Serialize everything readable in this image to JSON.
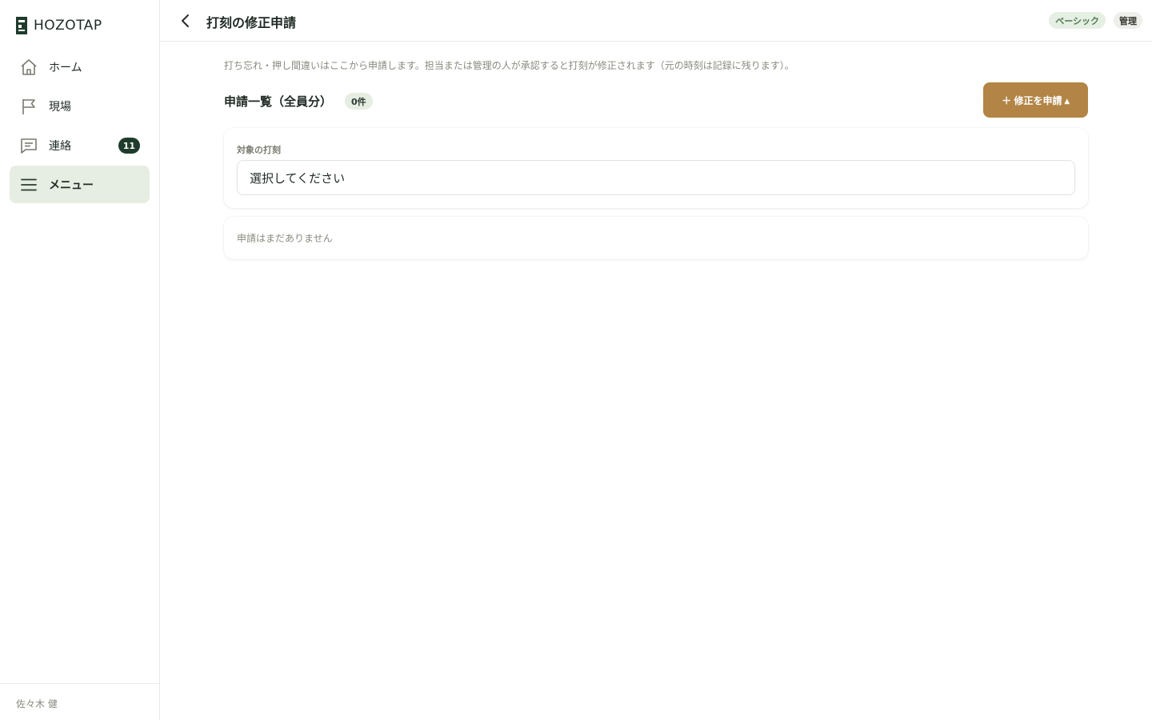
{
  "app": {
    "logo_text": "HOZOTAP"
  },
  "sidebar": {
    "items": [
      {
        "label": "ホーム",
        "icon": "home-icon"
      },
      {
        "label": "現場",
        "icon": "flag-icon"
      },
      {
        "label": "連絡",
        "icon": "message-icon",
        "badge": "11"
      },
      {
        "label": "メニュー",
        "icon": "menu-icon",
        "active": true
      }
    ],
    "user_name": "佐々木 健"
  },
  "header": {
    "title": "打刻の修正申請",
    "plan_badge": "ベーシック",
    "role_badge": "管理"
  },
  "main": {
    "intro": "打ち忘れ・押し間違いはここから申請します。担当または管理の人が承認すると打刻が修正されます（元の時刻は記録に残ります）。",
    "section_title": "申請一覧（全員分）",
    "count_badge": "0件",
    "request_button": "＋ 修正を申請 ▴",
    "form": {
      "label": "対象の打刻",
      "select_value": "選択してください"
    },
    "empty_message": "申請はまだありません"
  },
  "colors": {
    "accent": "#b28546",
    "active_nav_bg": "#e6ede3",
    "badge_dark": "#1f3b2c"
  }
}
